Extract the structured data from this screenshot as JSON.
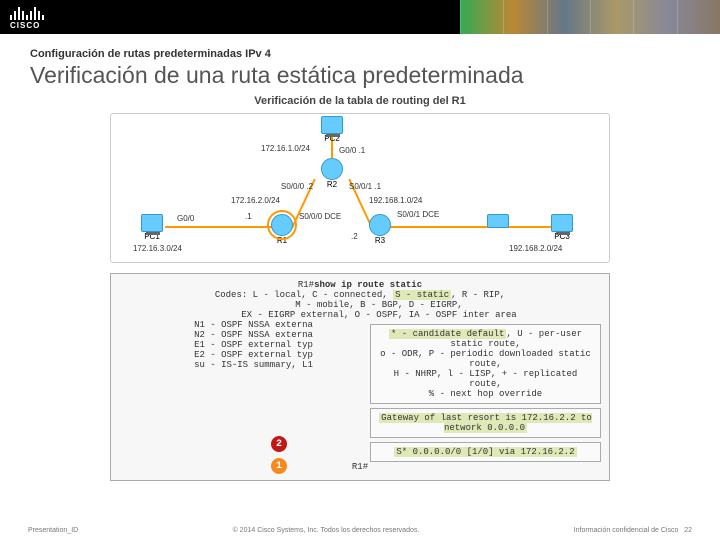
{
  "banner": {
    "brand": "CISCO"
  },
  "subtitle": "Configuración de rutas predeterminadas IPv 4",
  "title": "Verificación de una ruta estática predeterminada",
  "diagram": {
    "caption": "Verificación de la tabla de routing del R1",
    "pcs": {
      "pc1": "PC1",
      "pc2": "PC2",
      "pc3": "PC3"
    },
    "routers": {
      "r1": "R1",
      "r2": "R2",
      "r3": "R3"
    },
    "nets": {
      "n1": "172.16.1.0/24",
      "n2": "172.16.2.0/24",
      "n3": "192.168.1.0/24",
      "n4": "172.16.3.0/24",
      "n5": "192.168.2.0/24"
    },
    "ifaces": {
      "g00_1a": "G0/0 .1",
      "g00_1b": "G0/0",
      "s000_dce": "S0/0/0 DCE",
      "s000_2": "S0/0/0 .2",
      "s001_1": "S0/0/1 .1",
      "s001_dce": "S0/0/1 DCE",
      "dot1": ".1",
      "dot2": ".2"
    }
  },
  "cli": {
    "prompt": "R1#",
    "cmd": "show ip route static",
    "codes_lead": "Codes:",
    "codes_line1": "L - local, C - connected,",
    "static_code": "S - static",
    "codes_line1b": ", R - RIP,",
    "codes_line2": "M - mobile, B - BGP, D - EIGRP,",
    "codes_line3": "EX - EIGRP external, O - OSPF, IA - OSPF inter area",
    "left": {
      "l1": "N1 - OSPF NSSA externa",
      "l2": "N2 - OSPF NSSA externa",
      "l3": "E1 - OSPF external typ",
      "l4": "E2 - OSPF external typ",
      "l5": "su - IS-IS summary, L1"
    },
    "right": {
      "r1a": "* - candidate default",
      "r1b": ", U - per-user static route,",
      "r2": "o - ODR, P - periodic downloaded static route,",
      "r3": "H - NHRP, l - LISP, + - replicated route,",
      "r4": "% - next hop override"
    },
    "gw_line": "Gateway of last resort is 172.16.2.2 to network 0.0.0.0",
    "route_line": "S*    0.0.0.0/0 [1/0] via 172.16.2.2",
    "prompt_end": "R1#"
  },
  "callouts": {
    "one": "1",
    "two": "2"
  },
  "footer": {
    "left": "Presentation_ID",
    "center": "© 2014 Cisco Systems, Inc. Todos los derechos reservados.",
    "right_a": "Información confidencial de Cisco",
    "right_b": "22"
  }
}
